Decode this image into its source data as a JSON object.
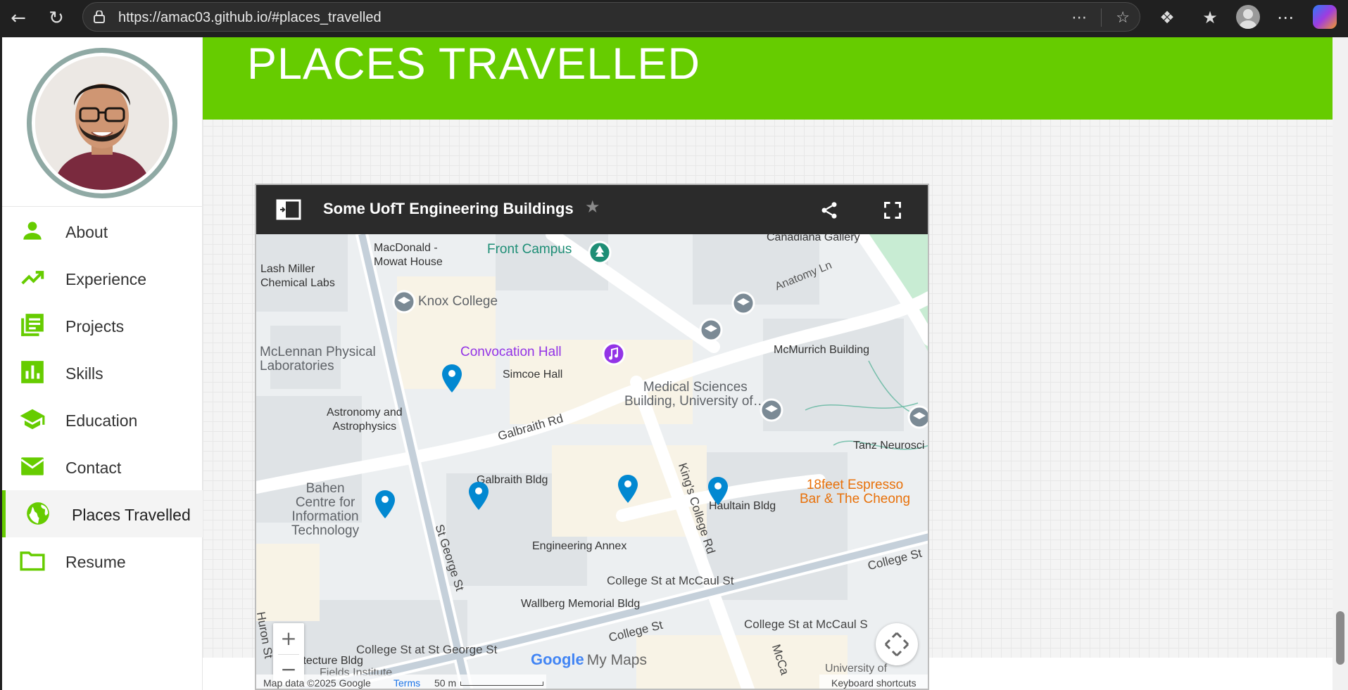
{
  "browser": {
    "url": "https://amac03.github.io/#places_travelled"
  },
  "sidebar": {
    "items": [
      {
        "label": "About",
        "icon": "person-icon"
      },
      {
        "label": "Experience",
        "icon": "trending-up-icon"
      },
      {
        "label": "Projects",
        "icon": "library-books-icon"
      },
      {
        "label": "Skills",
        "icon": "bar-chart-icon"
      },
      {
        "label": "Education",
        "icon": "school-icon"
      },
      {
        "label": "Contact",
        "icon": "mail-icon"
      },
      {
        "label": "Places Travelled",
        "icon": "globe-icon",
        "active": true
      },
      {
        "label": "Resume",
        "icon": "folder-icon"
      }
    ]
  },
  "main": {
    "heading": "PLACES TRAVELLED"
  },
  "map": {
    "title": "Some UofT Engineering Buildings",
    "labels": {
      "canadiana": "Canadiana Gallery",
      "macdonald": "MacDonald -\nMowat House",
      "front_campus": "Front Campus",
      "lash_miller": "Lash Miller\nChemical Labs",
      "knox": "Knox College",
      "anatomy": "Anatomy Ln",
      "mclennan": "McLennan Physical\nLaboratories",
      "convocation": "Convocation Hall",
      "simcoe": "Simcoe Hall",
      "mcmurrich": "McMurrich Building",
      "medical": "Medical Sciences\nBuilding, University of…",
      "astronomy": "Astronomy and\nAstrophysics",
      "galbraith_rd": "Galbraith Rd",
      "tanz": "Tanz Neurosci",
      "bahen": "Bahen\nCentre for\nInformation\nTechnology",
      "galbraith_bldg": "Galbraith Bldg",
      "kings_college": "King's College Rd",
      "haultain": "Haultain Bldg",
      "espresso": "18feet Espresso\nBar & The Cheong",
      "st_george": "St George St",
      "eng_annex": "Engineering Annex",
      "college_mccaul": "College St at McCaul St",
      "college_st": "College St",
      "college_st2": "College St",
      "wallberg": "Wallberg Memorial Bldg",
      "college_mccaul2": "College St at McCaul S",
      "huron": "Huron St",
      "college_stgeorge": "College St at St George St",
      "architecture": "Architecture Bldg",
      "fields": "Fields Institute",
      "mccaul": "McCa",
      "uoft": "University of"
    },
    "google_logo": "Google",
    "my_maps": "My Maps",
    "map_data": "Map data ©2025 Google",
    "terms": "Terms",
    "scale": "50 m",
    "keyboard_shortcuts": "Keyboard shortcuts",
    "zoom_in": "+",
    "zoom_out": "−"
  },
  "colors": {
    "accent": "#66cc00",
    "map_header": "#2b2b2b",
    "pin": "#0288d1"
  }
}
